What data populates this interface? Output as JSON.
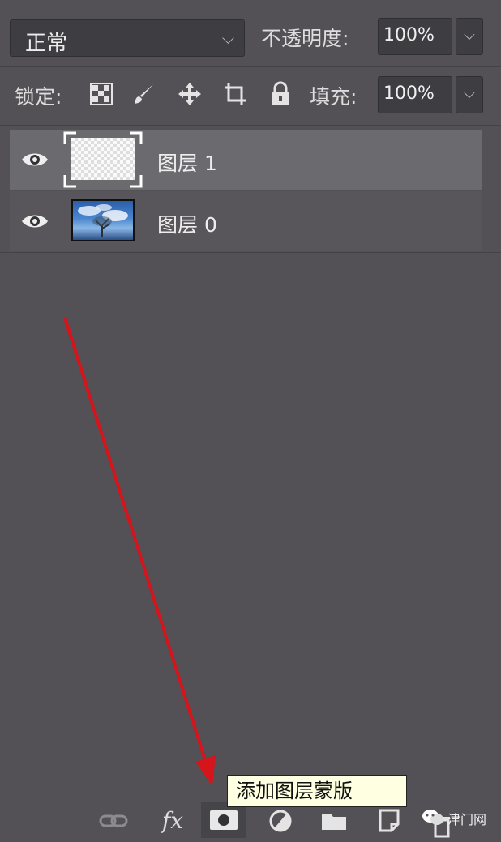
{
  "top_bar": {
    "blend_mode": "正常",
    "opacity_label": "不透明度:",
    "opacity_value": "100%"
  },
  "lock_bar": {
    "lock_label": "锁定:",
    "fill_label": "填充:",
    "fill_value": "100%",
    "lock_icons": [
      "checkerboard-lock-icon",
      "brush-lock-icon",
      "move-lock-icon",
      "artboard-lock-icon",
      "padlock-icon"
    ]
  },
  "layers": [
    {
      "name": "图层 1",
      "selected": true,
      "thumbnail": "transparent"
    },
    {
      "name": "图层 0",
      "selected": false,
      "thumbnail": "sky-photo"
    }
  ],
  "toolbar": {
    "fx_label": "fx",
    "icons": [
      "link-icon",
      "fx-icon",
      "add-mask-icon",
      "adjustment-icon",
      "folder-icon",
      "new-layer-icon",
      "trash-icon"
    ]
  },
  "tooltip": {
    "text": "添加图层蒙版"
  },
  "watermark": {
    "text": "津门网"
  },
  "colors": {
    "panel_bg": "#535155",
    "selected_row": "#6b6a6f",
    "arrow": "#d6141c",
    "tooltip_bg": "#ffffe1"
  }
}
